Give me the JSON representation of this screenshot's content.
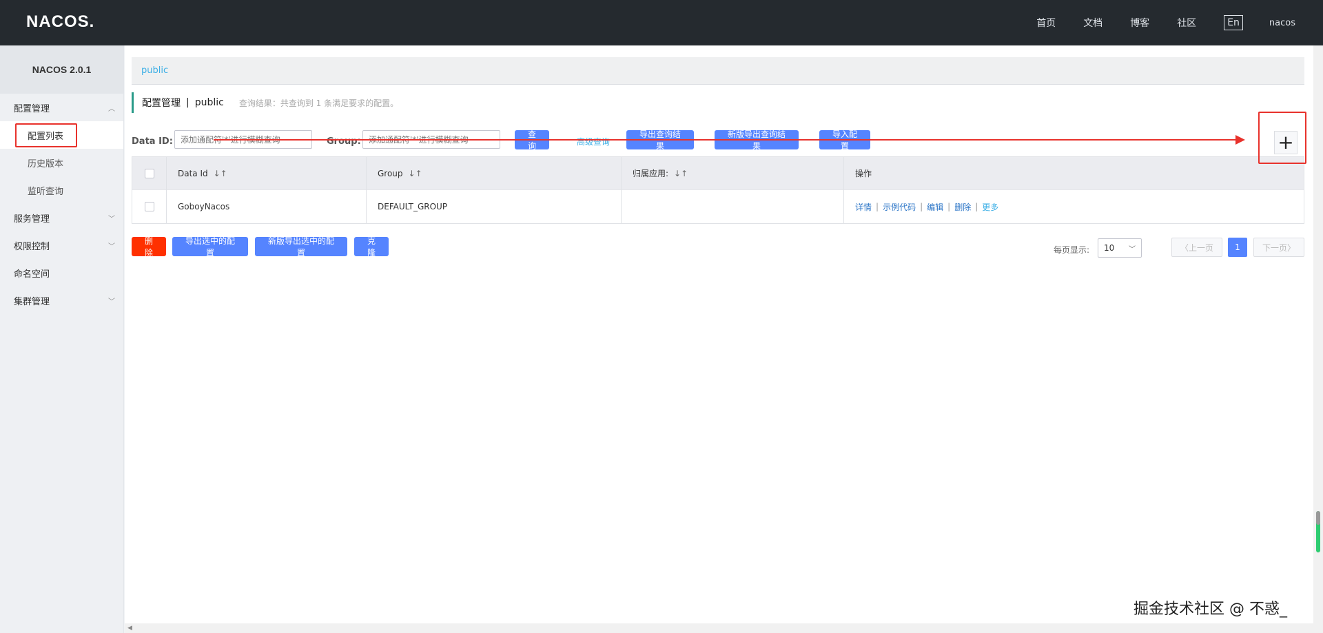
{
  "header": {
    "logo": "NACOS.",
    "nav": [
      "首页",
      "文档",
      "博客",
      "社区"
    ],
    "lang": "En",
    "user": "nacos"
  },
  "sidebar": {
    "title": "NACOS 2.0.1",
    "groups": [
      {
        "label": "配置管理",
        "chevron": "^",
        "items": [
          "配置列表",
          "历史版本",
          "监听查询"
        ]
      },
      {
        "label": "服务管理",
        "chevron": "v"
      },
      {
        "label": "权限控制",
        "chevron": "v"
      },
      {
        "label": "命名空间"
      },
      {
        "label": "集群管理",
        "chevron": "v"
      }
    ]
  },
  "main": {
    "breadcrumb": "public",
    "page_title": "配置管理",
    "title_sep": "|",
    "namespace": "public",
    "result_hint": "查询结果：共查询到 1 条满足要求的配置。",
    "search": {
      "dataid_label": "Data ID:",
      "dataid_placeholder": "添加通配符'*'进行模糊查询",
      "group_label": "Group:",
      "group_placeholder": "添加通配符'*'进行模糊查询",
      "query_btn": "查询",
      "advanced_link": "高级查询",
      "export_btn": "导出查询结果",
      "new_export_btn": "新版导出查询结果",
      "import_btn": "导入配置",
      "add_btn": "+"
    },
    "table": {
      "headers": [
        "Data Id",
        "Group",
        "归属应用:",
        "操作"
      ],
      "sort_icon": "↓↑",
      "rows": [
        {
          "data_id": "GoboyNacos",
          "group": "DEFAULT_GROUP",
          "app": "",
          "ops": [
            "详情",
            "示例代码",
            "编辑",
            "删除"
          ],
          "more": "更多"
        }
      ],
      "op_sep": "|"
    },
    "actions": {
      "delete_btn": "删除",
      "export_selected_btn": "导出选中的配置",
      "new_export_selected_btn": "新版导出选中的配置",
      "clone_btn": "克隆"
    },
    "pager": {
      "page_size_label": "每页显示:",
      "page_size": "10",
      "prev": "上一页",
      "current": "1",
      "next": "下一页"
    }
  },
  "watermark": "掘金技术社区 @ 不惑_",
  "colors": {
    "header_bg": "#252a2f",
    "primary": "#5584ff",
    "danger": "#ff3000",
    "link": "#3cafe6",
    "annotation": "#e8322c"
  }
}
